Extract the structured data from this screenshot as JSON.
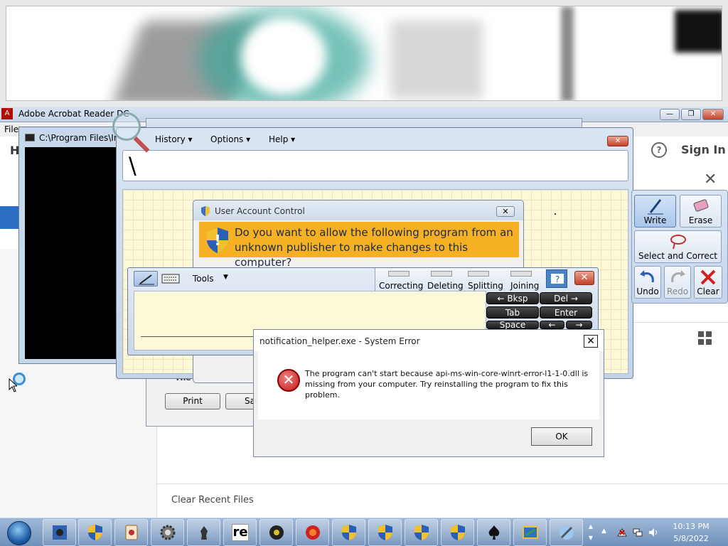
{
  "acrobat": {
    "title": "Adobe Acrobat Reader DC",
    "menu_file": "File",
    "home_label": "H",
    "help_glyph": "?",
    "signin": "Sign In",
    "clear_recent": "Clear Recent Files",
    "close_glyph": "✕"
  },
  "cmd": {
    "title": "C:\\Program Files\\Int"
  },
  "back_dialog": {
    "print": "Print",
    "save_partial": "Sa",
    "fragment": "The"
  },
  "tip": {
    "menu": {
      "history": "History",
      "options": "Options",
      "help": "Help"
    },
    "input_text": "\\",
    "tools": "Tools",
    "gestures": [
      "Correcting",
      "Deleting",
      "Splitting",
      "Joining"
    ],
    "keys": {
      "bksp": "← Bksp",
      "del": "Del →",
      "tab": "Tab",
      "enter": "Enter",
      "space": "Space",
      "left": "←",
      "right": "→"
    }
  },
  "uac": {
    "title": "User Account Control",
    "question": "Do you want to allow the following program from an unknown publisher to make changes to this computer?"
  },
  "pen_panel": {
    "write": "Write",
    "erase": "Erase",
    "select_correct": "Select and Correct",
    "undo": "Undo",
    "redo": "Redo",
    "clear": "Clear"
  },
  "error_dialog": {
    "title": "notification_helper.exe - System Error",
    "message": "The program can't start because api-ms-win-core-winrt-error-l1-1-0.dll is missing from your computer. Try reinstalling the program to fix this problem.",
    "ok": "OK",
    "close_glyph": "✕"
  },
  "taskbar": {
    "time": "10:13 PM",
    "date": "5/8/2022",
    "re_label": "re",
    "apps": [
      "spider-solitaire-icon",
      "shield-icon",
      "mahjong-icon",
      "gear-icon",
      "chess-icon",
      "re-icon",
      "ball-icon",
      "swirl-icon",
      "shield-icon",
      "shield-icon",
      "shield-icon",
      "shield-icon",
      "spades-icon",
      "board-icon",
      "tool-icon"
    ]
  },
  "colors": {
    "uac_banner": "#f5b023",
    "taskbar": "#6f90bb",
    "error_red": "#c41a1a"
  }
}
